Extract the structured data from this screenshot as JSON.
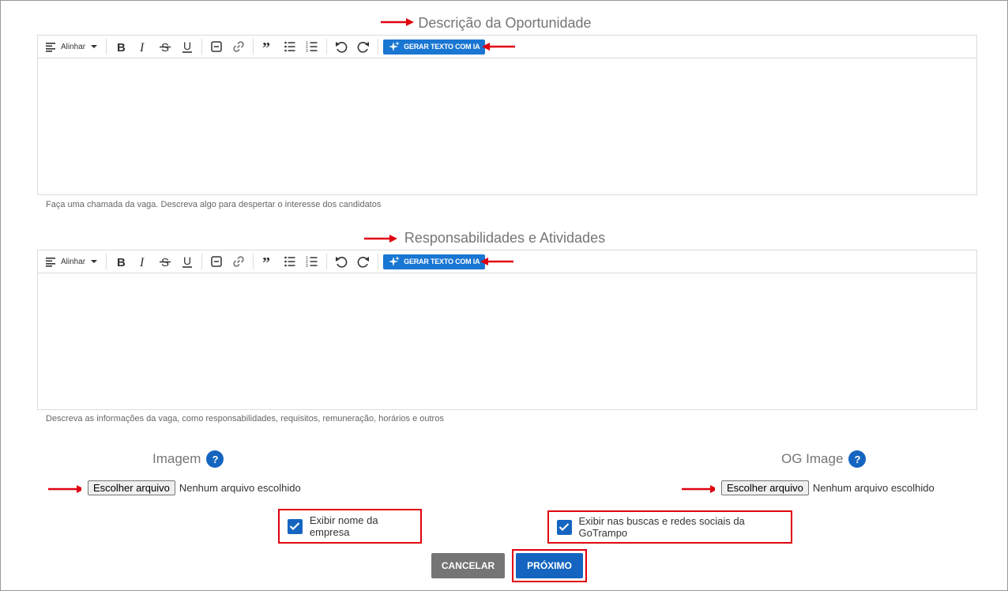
{
  "descricao": {
    "title": "Descrição da Oportunidade",
    "helper": "Faça uma chamada da vaga. Descreva algo para despertar o interesse dos candidatos"
  },
  "responsabilidades": {
    "title": "Responsabilidades e Atividades",
    "helper": "Descreva as informações da vaga, como responsabilidades, requisitos, remuneração, horários e outros"
  },
  "toolbar": {
    "align_label": "Alinhar",
    "ia_label": "GERAR TEXTO COM IA",
    "icons": [
      "align-icon",
      "bold-icon",
      "italic-icon",
      "strikethrough-icon",
      "underline-icon",
      "horizontal-rule-icon",
      "link-icon",
      "quote-icon",
      "bullet-list-icon",
      "numbered-list-icon",
      "undo-icon",
      "redo-icon",
      "sparkle-icon"
    ]
  },
  "imagem": {
    "label": "Imagem",
    "help": "?",
    "button": "Escolher arquivo",
    "status": "Nenhum arquivo escolhido"
  },
  "og_image": {
    "label": "OG Image",
    "help": "?",
    "button": "Escolher arquivo",
    "status": "Nenhum arquivo escolhido"
  },
  "checkboxes": {
    "exibir_nome": {
      "label": "Exibir nome da empresa",
      "checked": true
    },
    "exibir_buscas": {
      "label": "Exibir nas buscas e redes sociais da GoTrampo",
      "checked": true
    }
  },
  "actions": {
    "cancel": "CANCELAR",
    "next": "PRÓXIMO"
  },
  "colors": {
    "accent": "#1976d2",
    "primary_button": "#1565c0",
    "cancel_button": "#757575",
    "highlight": "#e0000f"
  }
}
